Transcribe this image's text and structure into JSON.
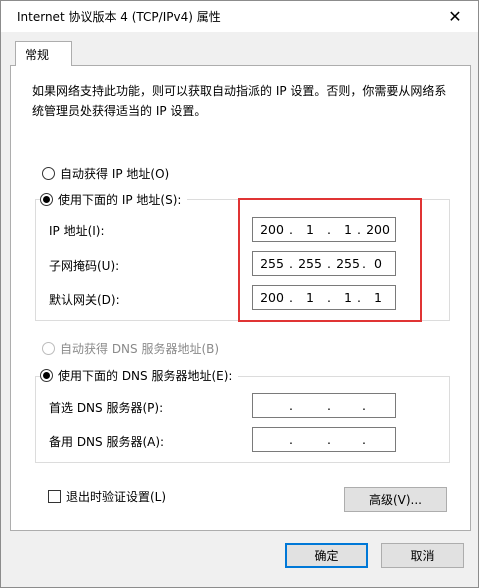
{
  "window": {
    "title": "Internet 协议版本 4 (TCP/IPv4) 属性",
    "close_glyph": "✕"
  },
  "tab": {
    "label": "常规"
  },
  "intro": {
    "text": "如果网络支持此功能，则可以获取自动指派的 IP 设置。否则，你需要从网络系统管理员处获得适当的 IP 设置。"
  },
  "ip_section": {
    "auto_label": "自动获得 IP 地址(O)",
    "manual_label": "使用下面的 IP 地址(S):",
    "selected": "manual",
    "fields": [
      {
        "label": "IP 地址(I):",
        "octets": [
          "200",
          "1",
          "1",
          "200"
        ]
      },
      {
        "label": "子网掩码(U):",
        "octets": [
          "255",
          "255",
          "255",
          "0"
        ]
      },
      {
        "label": "默认网关(D):",
        "octets": [
          "200",
          "1",
          "1",
          "1"
        ]
      }
    ]
  },
  "dns_section": {
    "auto_label": "自动获得 DNS 服务器地址(B)",
    "manual_label": "使用下面的 DNS 服务器地址(E):",
    "selected": "manual",
    "fields": [
      {
        "label": "首选 DNS 服务器(P):",
        "octets": [
          "",
          "",
          "",
          ""
        ]
      },
      {
        "label": "备用 DNS 服务器(A):",
        "octets": [
          "",
          "",
          "",
          ""
        ]
      }
    ]
  },
  "validate_on_exit": {
    "label": "退出时验证设置(L)",
    "checked": false
  },
  "buttons": {
    "advanced": "高级(V)...",
    "ok": "确定",
    "cancel": "取消"
  },
  "colors": {
    "highlight": "#e03434",
    "accent": "#0078d7"
  }
}
